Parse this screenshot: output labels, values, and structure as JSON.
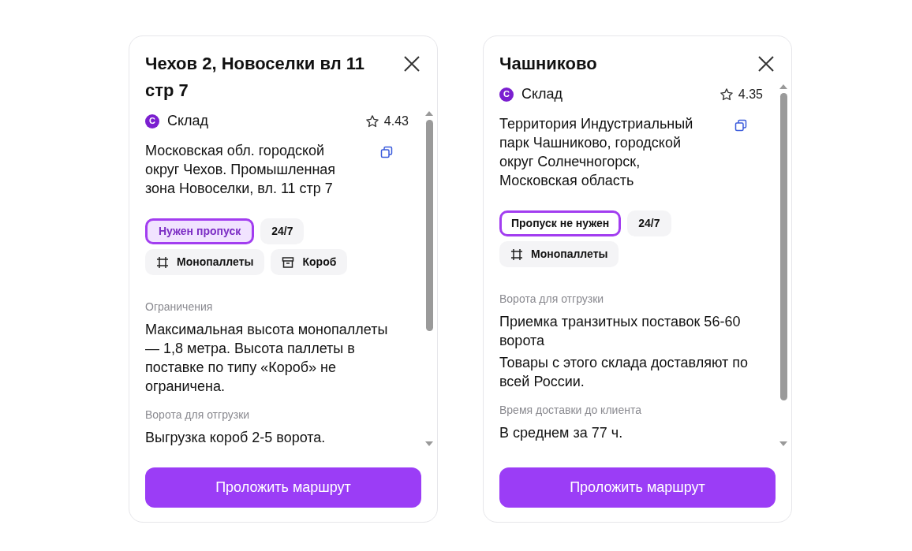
{
  "cards": [
    {
      "title": "Чехов 2, Новоселки вл 11 стр 7",
      "type_badge": "С",
      "type_label": "Склад",
      "rating": "4.43",
      "address": "Московская обл. городской округ Чехов. Промышленная зона Новоселки, вл. 11 стр 7",
      "tags": [
        {
          "kind": "pass-required",
          "label": "Нужен пропуск"
        },
        {
          "kind": "plain",
          "label": "24/7"
        },
        {
          "kind": "pallet",
          "label": "Монопаллеты"
        },
        {
          "kind": "box",
          "label": "Короб"
        }
      ],
      "sections": [
        {
          "label": "Ограничения",
          "paragraphs": [
            "Максимальная высота монопаллеты — 1,8 метра. Высота паллеты в поставке по типу «Короб» не ограничена."
          ]
        },
        {
          "label": "Ворота для отгрузки",
          "paragraphs": [
            "Выгрузка короб 2-5 ворота."
          ]
        }
      ],
      "button": "Проложить маршрут"
    },
    {
      "title": "Чашниково",
      "type_badge": "С",
      "type_label": "Склад",
      "rating": "4.35",
      "address": "Территория Индустриальный парк Чашниково, городской округ Солнечногорск, Московская область",
      "tags": [
        {
          "kind": "pass-free",
          "label": "Пропуск не нужен"
        },
        {
          "kind": "plain",
          "label": "24/7"
        },
        {
          "kind": "pallet",
          "label": "Монопаллеты"
        }
      ],
      "sections": [
        {
          "label": "Ворота для отгрузки",
          "paragraphs": [
            "Приемка транзитных поставок 56-60 ворота",
            "Товары с этого склада доставляют по всей России."
          ]
        },
        {
          "label": "Время доставки до клиента",
          "paragraphs": [
            "В среднем за 77 ч."
          ]
        }
      ],
      "button": "Проложить маршрут"
    }
  ]
}
